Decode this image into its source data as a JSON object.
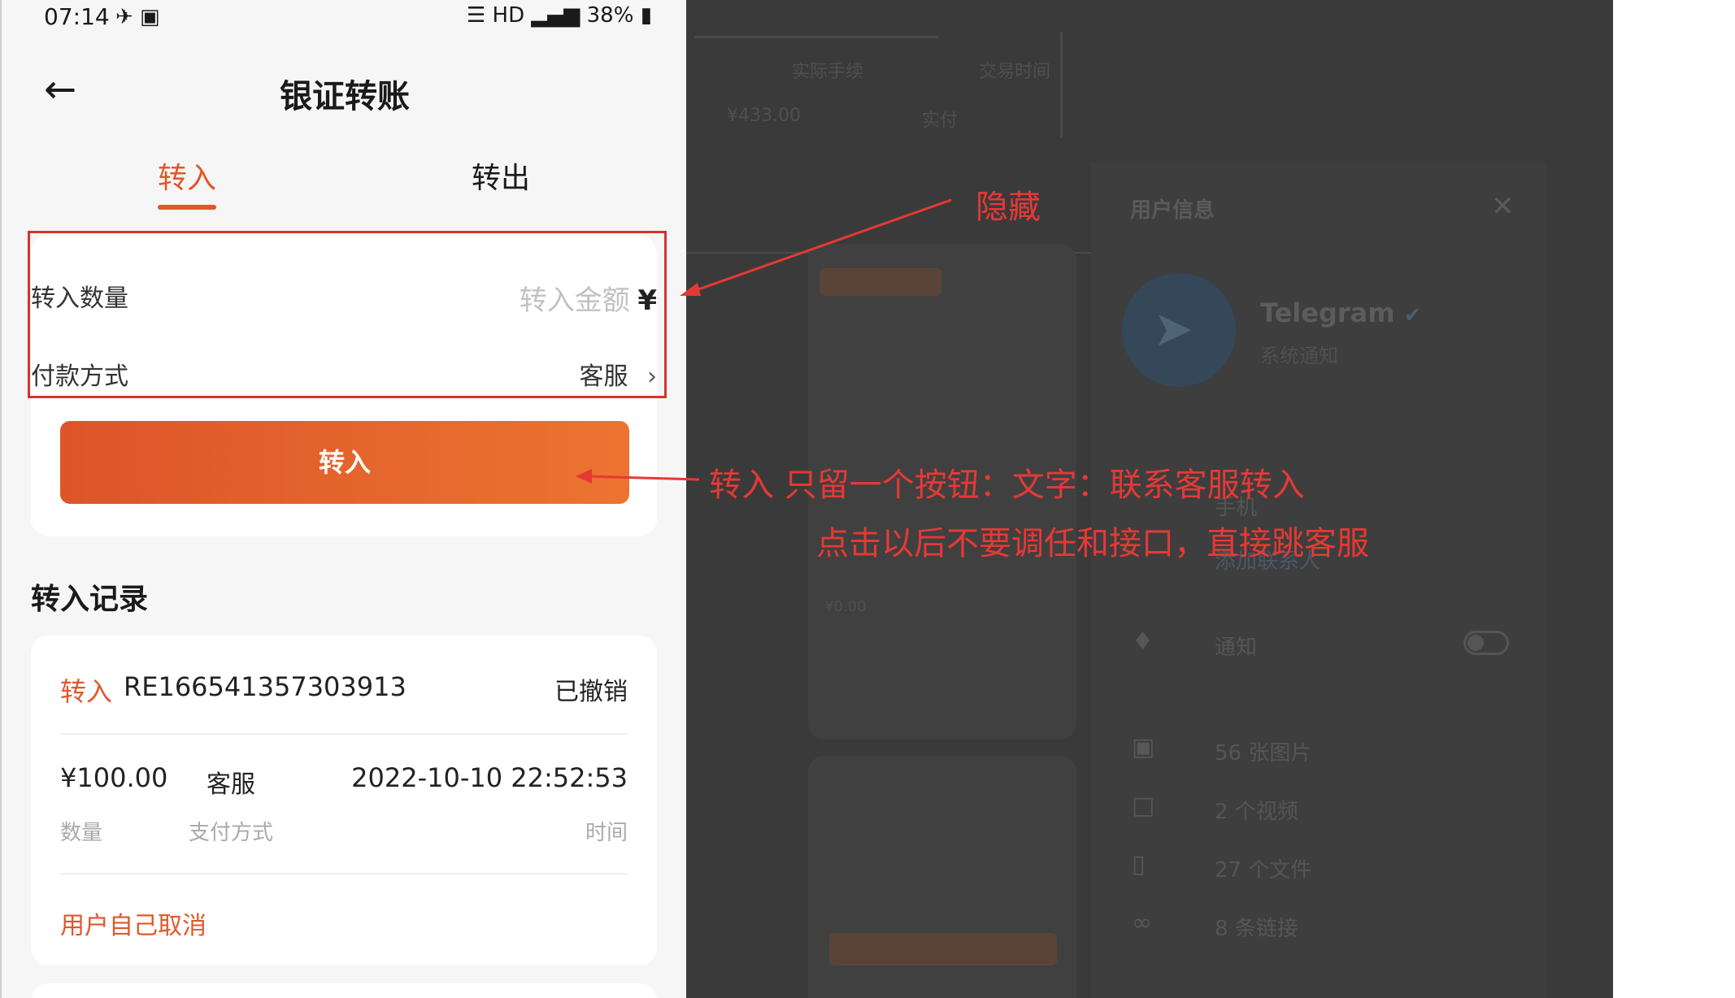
{
  "status_bar": {
    "time": "07:14",
    "left_icons": "✈ ▣",
    "right_icons": "☰ HD ▂▄▆",
    "battery": "38%"
  },
  "header": {
    "back_icon": "←",
    "title": "银证转账"
  },
  "tabs": {
    "in_label": "转入",
    "out_label": "转出",
    "active": "转入"
  },
  "form": {
    "amount_label": "转入数量",
    "amount_placeholder": "转入金额",
    "amount_currency": "¥",
    "payment_label": "付款方式",
    "payment_value": "客服",
    "payment_chevron": "›",
    "submit_label": "转入"
  },
  "records": {
    "section_title": "转入记录",
    "items": [
      {
        "type": "转入",
        "id": "RE166541357303913",
        "status": "已撤销",
        "amount": "¥100.00",
        "method": "客服",
        "time": "2022-10-10 22:52:53",
        "amount_label": "数量",
        "method_label": "支付方式",
        "time_label": "时间",
        "note": "用户自己取消"
      }
    ]
  },
  "annotations": {
    "hide_note": "隐藏",
    "button_note": "转入  只留一个按钮：文字：联系客服转入",
    "click_note": "点击以后不要调任和接口，直接跳客服",
    "color": "#e53935"
  },
  "background_telegram": {
    "header": "用户信息",
    "close_icon": "✕",
    "name": "Telegram",
    "verified_icon": "✔",
    "subtitle": "系统通知",
    "phone_label": "手机",
    "add_contact": "添加联系人",
    "notifications": "通知",
    "media": [
      "56 张图片",
      "2 个视频",
      "27 个文件",
      "8 条链接"
    ],
    "icons": [
      "bell-icon",
      "image-icon",
      "video-icon",
      "file-icon",
      "link-icon"
    ]
  },
  "background_misc": {
    "ghost_amount": "¥433.00",
    "ghost_fee": "实际手续",
    "ghost_time": "交易时间",
    "ghost_pay": "实付",
    "mini_amount": "¥0.00"
  },
  "colors": {
    "accent": "#e0582a",
    "button_start": "#dd5429",
    "button_end": "#ec7430",
    "annotation_red": "#e53935"
  }
}
